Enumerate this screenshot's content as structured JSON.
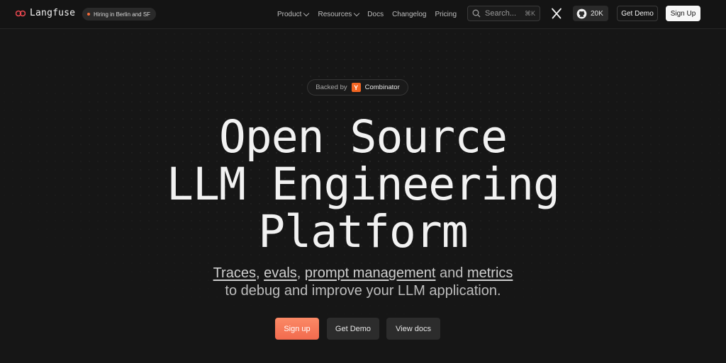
{
  "brand": {
    "name": "Langfuse",
    "accent": "#f26b3a"
  },
  "hiring_badge": "Hiring in Berlin and SF",
  "nav": [
    {
      "label": "Product",
      "dropdown": true
    },
    {
      "label": "Resources",
      "dropdown": true
    },
    {
      "label": "Docs",
      "dropdown": false
    },
    {
      "label": "Changelog",
      "dropdown": false
    },
    {
      "label": "Pricing",
      "dropdown": false
    }
  ],
  "search": {
    "placeholder": "Search...",
    "shortcut": "⌘K"
  },
  "social": {
    "x_icon": "x-icon",
    "github_icon": "github-icon",
    "github_stars": "20K"
  },
  "header_buttons": {
    "demo": "Get Demo",
    "signup": "Sign Up"
  },
  "badge": {
    "prefix": "Backed by",
    "logo_letter": "Y",
    "name": "Combinator"
  },
  "hero": {
    "title_lines": [
      "Open Source",
      "LLM Engineering",
      "Platform"
    ],
    "subtitle": {
      "link1": "Traces",
      "sep1": ", ",
      "link2": "evals",
      "sep2": ", ",
      "link3": "prompt management",
      "sep3": " and ",
      "link4": "metrics",
      "line2": "to debug and improve your LLM application."
    }
  },
  "cta": {
    "signup": "Sign up",
    "demo": "Get Demo",
    "docs": "View docs"
  }
}
